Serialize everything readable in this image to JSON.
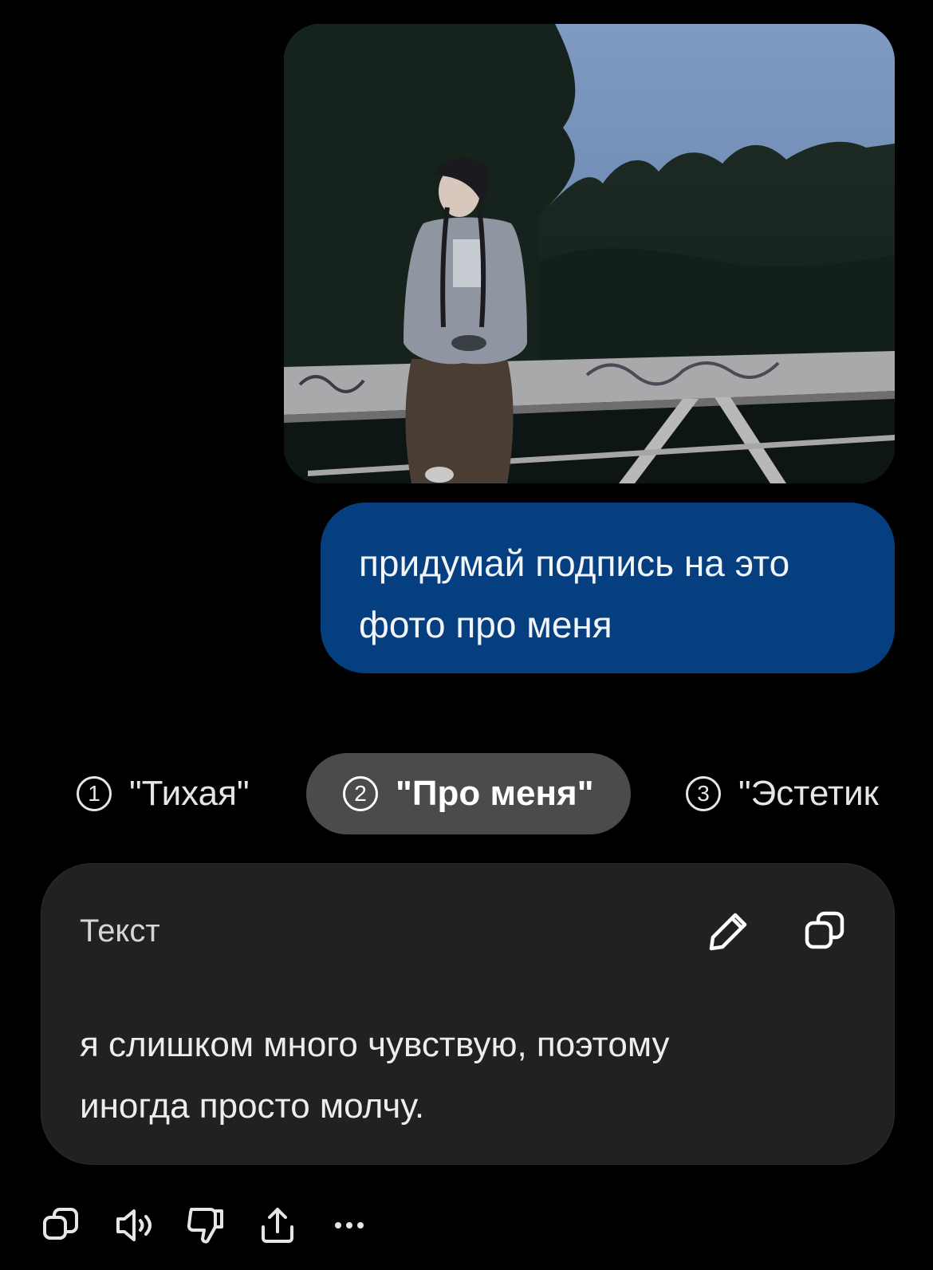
{
  "message": {
    "text_line1": "придумай подпись на это",
    "text_line2": "фото про меня"
  },
  "variants": [
    {
      "number": "1",
      "label": "\"Тихая\""
    },
    {
      "number": "2",
      "label": "\"Про меня\""
    },
    {
      "number": "3",
      "label": "\"Эстетик"
    }
  ],
  "card": {
    "label": "Текст",
    "text_line1": "я слишком много чувствую, поэтому",
    "text_line2": "иногда просто молчу."
  },
  "icons": {
    "edit": "pencil-icon",
    "copy": "copy-icon",
    "speak": "speaker-icon",
    "dislike": "thumbs-down-icon",
    "share": "share-icon",
    "more": "more-icon"
  },
  "colors": {
    "background": "#000000",
    "user_bubble": "#063f7f",
    "active_variant": "#4b4b4b",
    "card": "#212121"
  }
}
